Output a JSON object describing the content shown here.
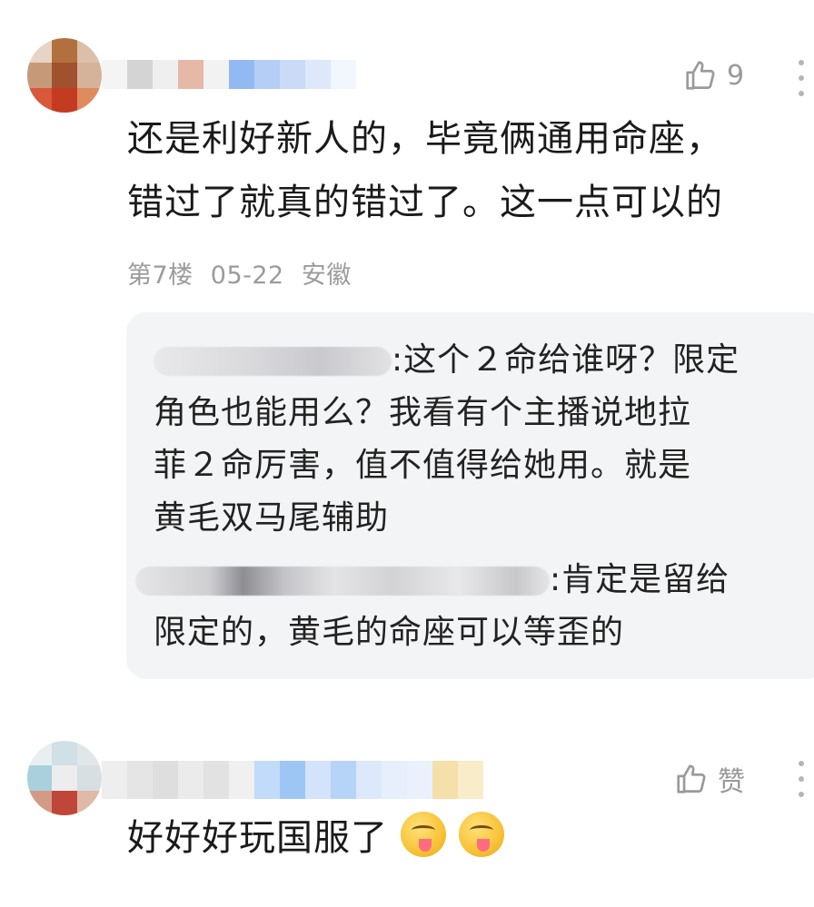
{
  "comment1": {
    "like_count": "9",
    "text_line1": "还是利好新人的，毕竟俩通用命座，",
    "text_line2": "错过了就真的错过了。这一点可以的",
    "floor": "第7楼",
    "date": "05-22",
    "location": "安徽",
    "replies": [
      {
        "text_line1": ":这个２命给谁呀？限定",
        "text_line2": "角色也能用么？我看有个主播说地拉",
        "text_line3": "菲２命厉害，值不值得给她用。就是",
        "text_line4": "黄毛双马尾辅助"
      },
      {
        "text_line1": ":肯定是留给",
        "text_line2": "限定的，黄毛的命座可以等歪的"
      }
    ]
  },
  "comment2": {
    "like_label": "赞",
    "text": "好好好玩国服了"
  },
  "icons": {
    "like": "thumbs-up-icon",
    "more": "more-vertical-icon",
    "emoji": "yum-face-emoji-icon"
  },
  "colors": {
    "meta_text": "#9b9b9b",
    "reply_bg": "#f3f4f6"
  }
}
